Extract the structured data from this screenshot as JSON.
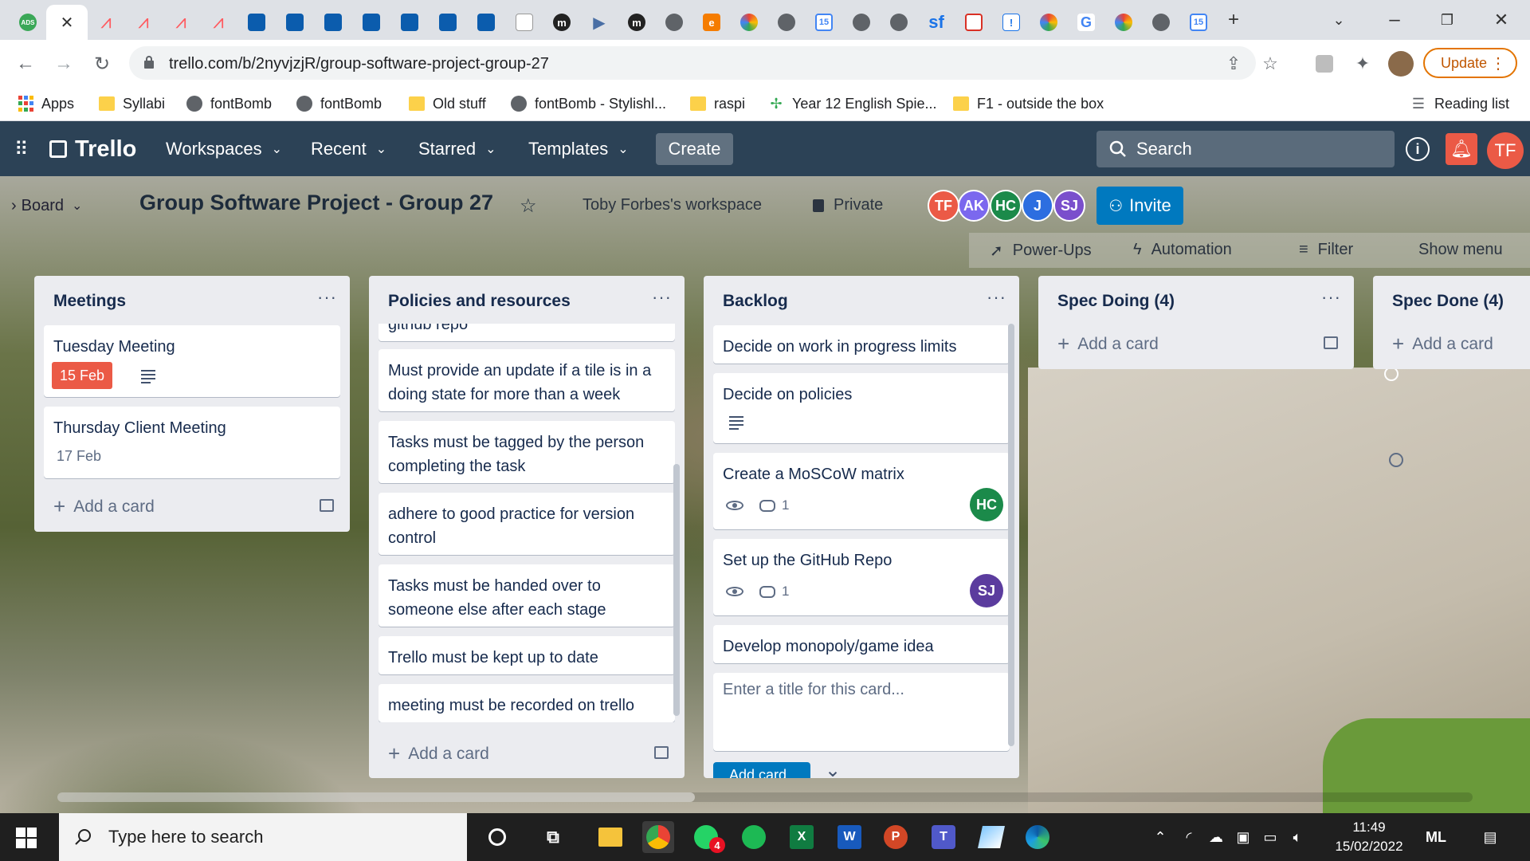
{
  "browser": {
    "tabs": [
      {
        "icon": "ads-icon",
        "color": "#3aa757",
        "label": "ADS"
      },
      {
        "icon": "close-icon",
        "active": true
      },
      {
        "icon": "airbnb-icon",
        "color": "#ff5a5f"
      },
      {
        "icon": "airbnb-icon",
        "color": "#ff5a5f"
      },
      {
        "icon": "airbnb-icon",
        "color": "#ff5a5f"
      },
      {
        "icon": "airbnb-icon",
        "color": "#ff5a5f"
      },
      {
        "icon": "university-icon",
        "color": "#0b5cad"
      },
      {
        "icon": "university-icon",
        "color": "#0b5cad"
      },
      {
        "icon": "university-icon",
        "color": "#0b5cad"
      },
      {
        "icon": "university-icon",
        "color": "#0b5cad"
      },
      {
        "icon": "university-icon",
        "color": "#0b5cad"
      },
      {
        "icon": "university-icon",
        "color": "#0b5cad"
      },
      {
        "icon": "university-icon",
        "color": "#0b5cad"
      },
      {
        "icon": "document-icon",
        "color": "#999999"
      },
      {
        "icon": "m-icon",
        "color": "#222222",
        "label": "m"
      },
      {
        "icon": "play-icon",
        "color": "#4a6fa5"
      },
      {
        "icon": "m-icon",
        "color": "#222222",
        "label": "m"
      },
      {
        "icon": "globe-icon",
        "color": "#5f6368"
      },
      {
        "icon": "e-icon",
        "color": "#f57c00",
        "label": "e"
      },
      {
        "icon": "color-wheel-icon",
        "color": "#f4b400"
      },
      {
        "icon": "globe-icon",
        "color": "#5f6368"
      },
      {
        "icon": "calendar-icon",
        "color": "#4285f4",
        "label": "15"
      },
      {
        "icon": "globe-icon",
        "color": "#5f6368"
      },
      {
        "icon": "globe-icon",
        "color": "#5f6368"
      },
      {
        "icon": "sf-icon",
        "color": "#1a73e8",
        "label": "sf"
      },
      {
        "icon": "gmail-icon",
        "color": "#d93025"
      },
      {
        "icon": "info-icon",
        "color": "#1a73e8",
        "label": "!"
      },
      {
        "icon": "color-wheel-icon",
        "color": "#f4b400"
      },
      {
        "icon": "google-icon",
        "color": "#4285f4",
        "label": "G"
      },
      {
        "icon": "color-wheel-icon",
        "color": "#f4b400"
      },
      {
        "icon": "globe-icon",
        "color": "#5f6368"
      },
      {
        "icon": "calendar-icon",
        "color": "#4285f4",
        "label": "15"
      }
    ],
    "url": "trello.com/b/2nyvjzjR/group-software-project-group-27",
    "update_label": "Update",
    "bookmarks": [
      {
        "label": "Apps",
        "icon": "apps-icon"
      },
      {
        "label": "Syllabi",
        "icon": "folder-icon"
      },
      {
        "label": "fontBomb",
        "icon": "globe-icon"
      },
      {
        "label": "fontBomb",
        "icon": "globe-icon"
      },
      {
        "label": "Old stuff",
        "icon": "folder-icon"
      },
      {
        "label": "fontBomb - Stylishl...",
        "icon": "globe-icon"
      },
      {
        "label": "raspi",
        "icon": "folder-icon"
      },
      {
        "label": "Year 12 English Spie...",
        "icon": "pinwheel-icon"
      },
      {
        "label": "F1 - outside the box",
        "icon": "folder-icon"
      }
    ],
    "reading_list": "Reading list"
  },
  "trello": {
    "logo": "Trello",
    "nav": [
      "Workspaces",
      "Recent",
      "Starred",
      "Templates"
    ],
    "create": "Create",
    "search_placeholder": "Search",
    "user_initials": "TF"
  },
  "board": {
    "view_label": "Board",
    "title": "Group Software Project - Group 27",
    "workspace": "Toby Forbes's workspace",
    "visibility": "Private",
    "members": [
      {
        "initials": "TF",
        "color": "#eb5a46"
      },
      {
        "initials": "AK",
        "color": "#7b68ee"
      },
      {
        "initials": "HC",
        "color": "#1b8a4a"
      },
      {
        "initials": "J",
        "color": "#2d6ee0"
      },
      {
        "initials": "SJ",
        "color": "#7a4fcc"
      }
    ],
    "invite": "Invite",
    "powerups": "Power-Ups",
    "automation": "Automation",
    "filter": "Filter",
    "show_menu": "Show menu"
  },
  "lists": {
    "meetings": {
      "title": "Meetings",
      "cards": [
        {
          "title": "Tuesday Meeting",
          "due": "15 Feb"
        },
        {
          "title": "Thursday Client Meeting",
          "date": "17 Feb"
        }
      ],
      "add": "Add a card"
    },
    "policies": {
      "title": "Policies and resources",
      "cards": [
        {
          "title": "github repo"
        },
        {
          "title": "Must provide an update if a tile is in a doing state for more than a week"
        },
        {
          "title": "Tasks must be tagged by the person completing the task"
        },
        {
          "title": "adhere to good practice for version control"
        },
        {
          "title": "Tasks must be handed over to someone else after each stage"
        },
        {
          "title": "Trello must be kept up to date"
        },
        {
          "title": "meeting must be recorded on trello"
        }
      ],
      "add": "Add a card"
    },
    "backlog": {
      "title": "Backlog",
      "cards": [
        {
          "title": "Decide on work in progress limits"
        },
        {
          "title": "Decide on policies"
        },
        {
          "title": "Create a MoSCoW matrix",
          "comments": "1",
          "member": "HC"
        },
        {
          "title": "Set up the GitHub Repo",
          "comments": "1",
          "member": "SJ"
        },
        {
          "title": "Develop monopoly/game idea"
        }
      ],
      "composer_placeholder": "Enter a title for this card...",
      "add_button": "Add card"
    },
    "spec_doing": {
      "title": "Spec Doing (4)",
      "add": "Add a card"
    },
    "spec_done": {
      "title": "Spec Done (4)",
      "add": "Add a card"
    }
  },
  "taskbar": {
    "search_placeholder": "Type here to search",
    "whatsapp_badge": "4",
    "time": "11:49",
    "date": "15/02/2022"
  }
}
